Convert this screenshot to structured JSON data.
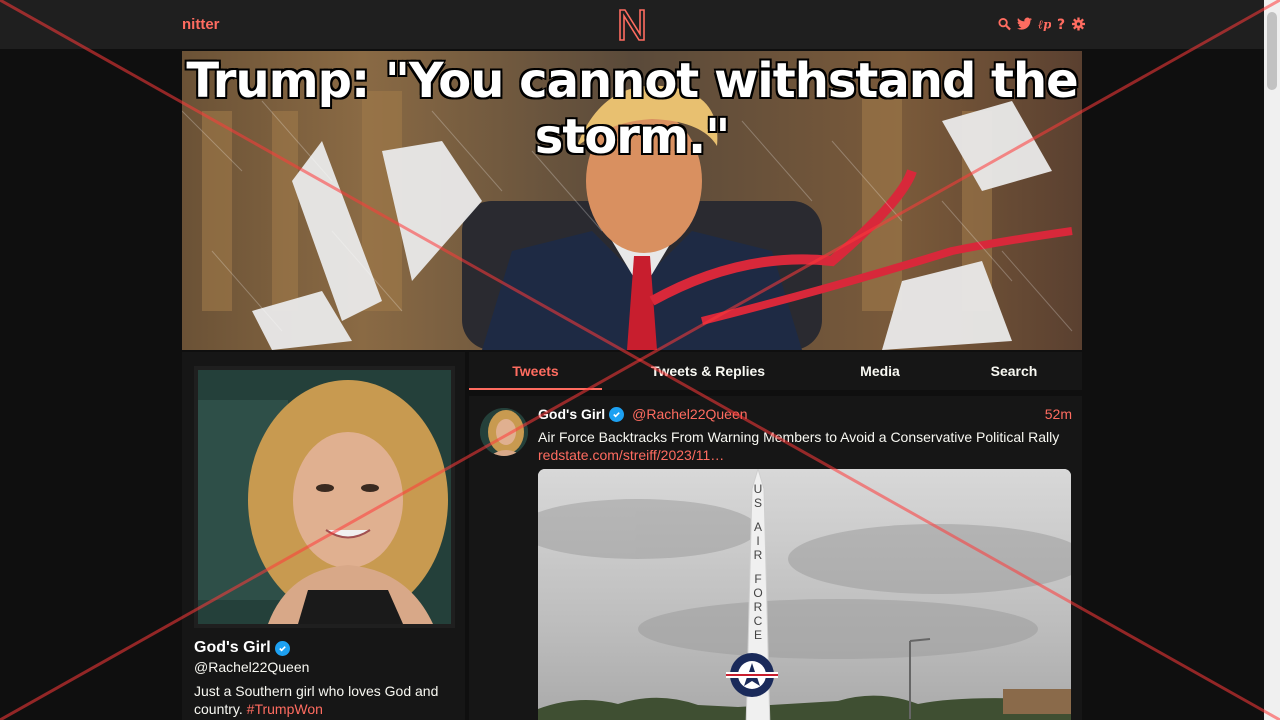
{
  "navbar": {
    "logo_text": "nitter",
    "center_logo_icon": "nitter-n-logo-icon",
    "icons": [
      "search-icon",
      "twitter-bird-icon",
      "rss-icon",
      "help-icon",
      "gear-icon"
    ]
  },
  "banner": {
    "title": "Trump: \"You cannot withstand the storm.\""
  },
  "profile": {
    "name": "God's Girl",
    "handle": "@Rachel22Queen",
    "bio_text": "Just a Southern girl who loves God and country. ",
    "bio_hashtag": "#TrumpWon"
  },
  "tabs": [
    {
      "label": "Tweets",
      "active": true
    },
    {
      "label": "Tweets & Replies",
      "active": false
    },
    {
      "label": "Media",
      "active": false
    },
    {
      "label": "Search",
      "active": false
    }
  ],
  "tweet": {
    "fullname": "God's Girl",
    "username": "@Rachel22Queen",
    "date": "52m",
    "text": "Air Force Backtracks From Warning Members to Avoid a Conservative Political Rally",
    "link": "redstate.com/streiff/2023/11…",
    "media_alt": "US AIR FORCE"
  },
  "colors": {
    "accent": "#ff6c60",
    "background": "#0f0f0f",
    "panel": "#161616",
    "navbar": "#1f1f1f",
    "verified": "#1da1f2"
  }
}
